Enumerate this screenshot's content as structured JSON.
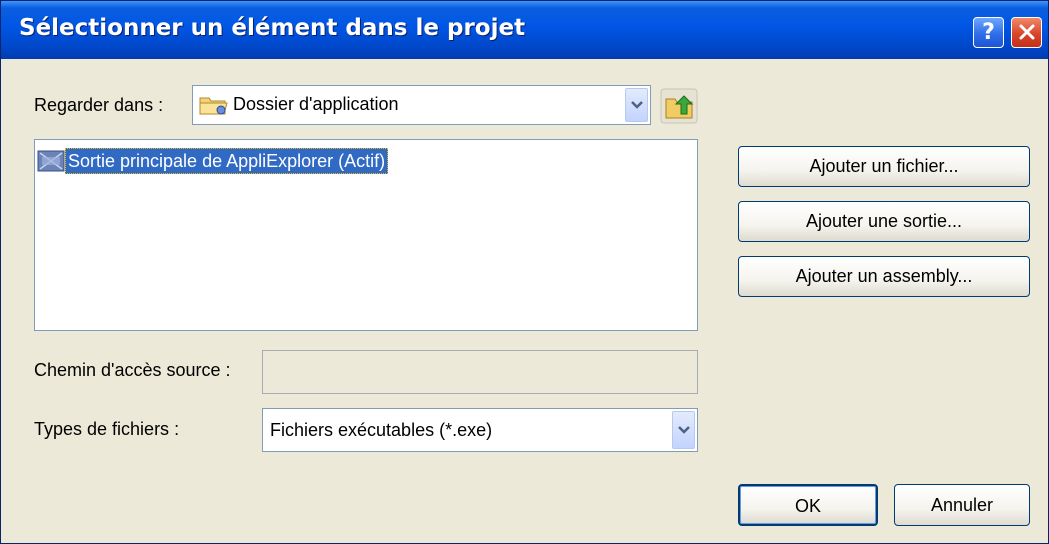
{
  "dialog": {
    "title": "Sélectionner un élément dans le projet",
    "help_label": "?",
    "close_label": "×"
  },
  "look_in": {
    "label": "Regarder dans :",
    "value": "Dossier d'application",
    "icon": "folder-icon"
  },
  "file_list": {
    "items": [
      {
        "label": "Sortie principale de AppliExplorer (Actif)",
        "selected": true,
        "icon": "project-output-icon"
      }
    ]
  },
  "buttons": {
    "add_file": "Ajouter un fichier...",
    "add_output": "Ajouter une sortie...",
    "add_assembly": "Ajouter un assembly...",
    "ok": "OK",
    "cancel": "Annuler"
  },
  "source_path": {
    "label": "Chemin d'accès source :",
    "value": ""
  },
  "file_types": {
    "label": "Types de fichiers :",
    "value": "Fichiers exécutables (*.exe)"
  },
  "colors": {
    "titlebar": "#0055e5",
    "dialog_bg": "#ece9d8",
    "selection": "#316ac5"
  }
}
